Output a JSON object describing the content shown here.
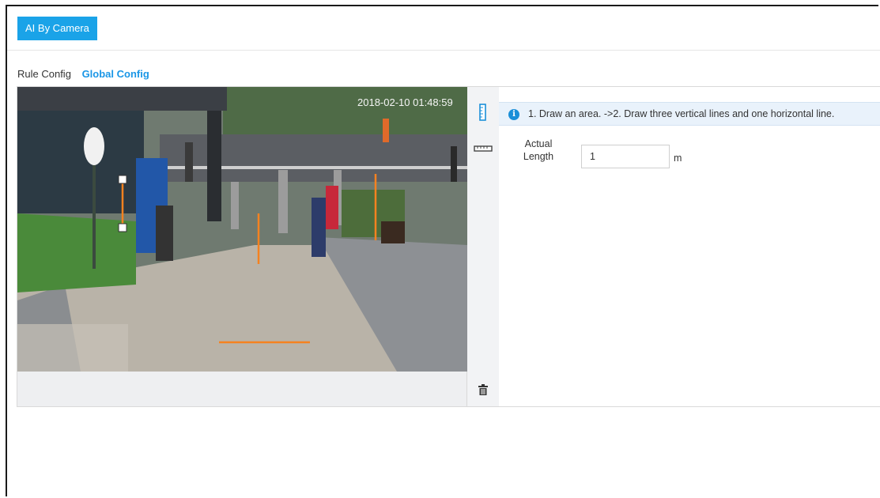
{
  "header": {
    "tab_label": "AI By Camera"
  },
  "subtabs": [
    {
      "label": "Rule Config",
      "active": false
    },
    {
      "label": "Global Config",
      "active": true
    }
  ],
  "video": {
    "timestamp": "2018-02-10 01:48:59",
    "calibration_line_color": "#f58220"
  },
  "toolbar": {
    "tools": [
      {
        "icon": "vertical-ruler-icon"
      },
      {
        "icon": "horizontal-ruler-icon"
      },
      {
        "icon": "trash-icon"
      }
    ]
  },
  "panel": {
    "info_text": "1. Draw an area. ->2. Draw three vertical lines and one horizontal line.",
    "info_icon": "info-icon",
    "length_label_line1": "Actual",
    "length_label_line2": "Length",
    "length_value": "1",
    "length_unit": "m"
  },
  "colors": {
    "accent": "#1aa3e8",
    "active_tab": "#1a96e6",
    "info_bg": "#e9f2fb"
  }
}
